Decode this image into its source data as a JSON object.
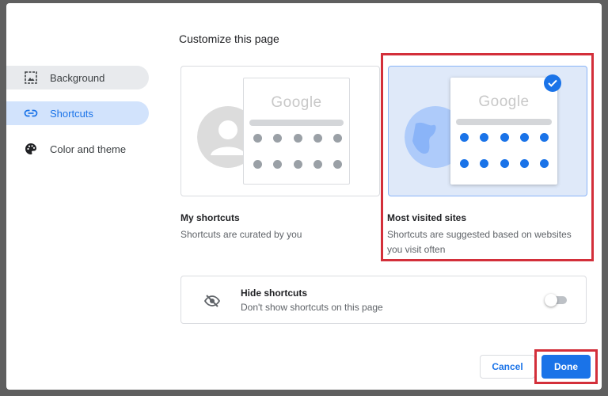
{
  "dialog": {
    "title": "Customize this page"
  },
  "sidebar": {
    "items": [
      {
        "label": "Background",
        "icon": "image-icon"
      },
      {
        "label": "Shortcuts",
        "icon": "link-icon"
      },
      {
        "label": "Color and theme",
        "icon": "palette-icon"
      }
    ],
    "active_index": 1
  },
  "options": {
    "my_shortcuts": {
      "title": "My shortcuts",
      "description": "Shortcuts are curated by you",
      "preview_logo": "Google",
      "selected": false
    },
    "most_visited": {
      "title": "Most visited sites",
      "description_line1": "Shortcuts are suggested based on websites",
      "description_line2": "you visit often",
      "preview_logo": "Google",
      "selected": true
    }
  },
  "hide_shortcuts": {
    "title": "Hide shortcuts",
    "description": "Don't show shortcuts on this page",
    "enabled": false
  },
  "buttons": {
    "cancel": "Cancel",
    "done": "Done"
  },
  "colors": {
    "accent": "#1a73e8",
    "highlight": "#d32f3a",
    "selected_card_bg": "#dfe9f9"
  }
}
